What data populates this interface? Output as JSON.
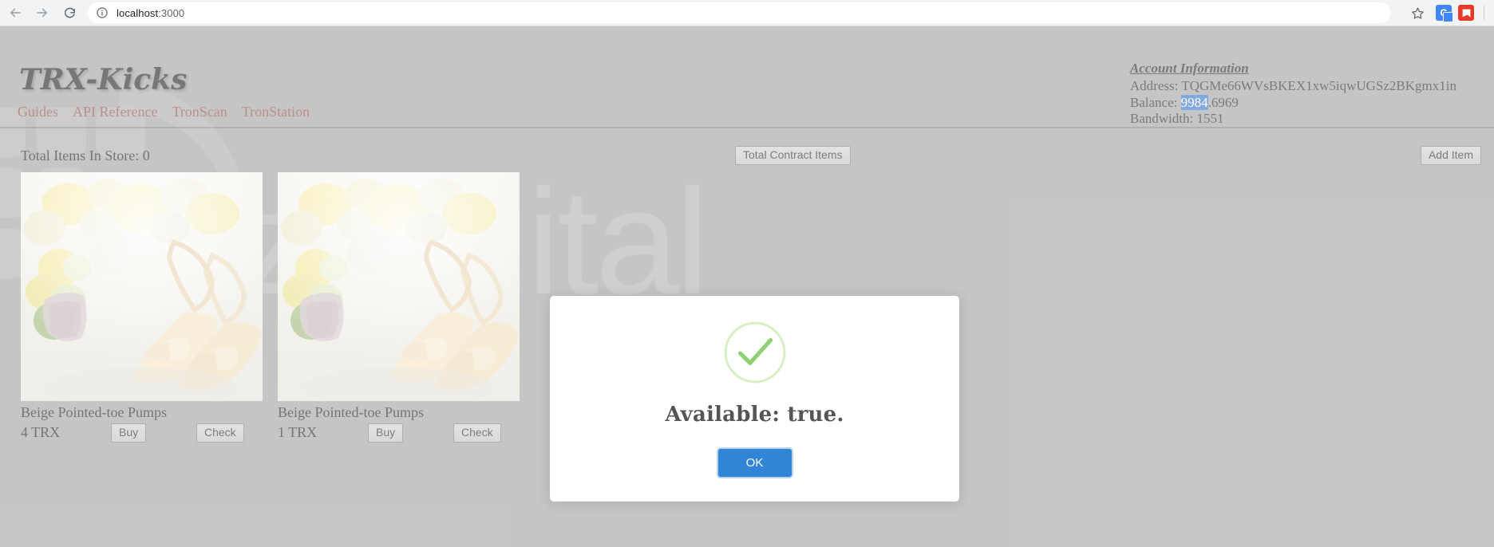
{
  "browser": {
    "back_icon": "back-arrow-icon",
    "forward_icon": "forward-arrow-icon",
    "reload_icon": "reload-icon",
    "site_info_icon": "info-circle-icon",
    "url_host": "localhost",
    "url_port": ":3000",
    "bookmark_icon": "star-icon",
    "translate_extension_label": "G",
    "extensions": [
      "google-translate-extension",
      "red-extension"
    ]
  },
  "site": {
    "brand": "TRX-Kicks",
    "nav": [
      {
        "label": "Guides"
      },
      {
        "label": "API Reference"
      },
      {
        "label": "TronScan"
      },
      {
        "label": "TronStation"
      }
    ],
    "watermark": "ArzDigital"
  },
  "account": {
    "title": "Account Information",
    "address_label": "Address: ",
    "address_value": "TQGMe66WVsBKEX1xw5iqwUGSz2BKgmx1in",
    "balance_label": "Balance: ",
    "balance_selected": "9984",
    "balance_rest": ".6969",
    "bandwidth_label": "Bandwidth: ",
    "bandwidth_value": "1551"
  },
  "store": {
    "total_items_text": "Total Items In Store: 0",
    "total_contract_items_label": "Total Contract Items",
    "add_item_label": "Add Item",
    "products": [
      {
        "name": "Beige Pointed-toe Pumps",
        "price": "4 TRX",
        "buy_label": "Buy",
        "check_label": "Check",
        "image_alt": "beige pointed-toe pumps with yellow flowers"
      },
      {
        "name": "Beige Pointed-toe Pumps",
        "price": "1 TRX",
        "buy_label": "Buy",
        "check_label": "Check",
        "image_alt": "beige pointed-toe pumps with yellow flowers"
      }
    ]
  },
  "modal": {
    "icon": "success-check-circle-icon",
    "message": "Available: true.",
    "ok_label": "OK"
  },
  "colors": {
    "nav_link": "#8d3b34",
    "page_background": "#9c9c9c",
    "modal_button": "#3085d6",
    "success_green": "#a5dc86",
    "selection_blue": "#2a6bc4"
  }
}
